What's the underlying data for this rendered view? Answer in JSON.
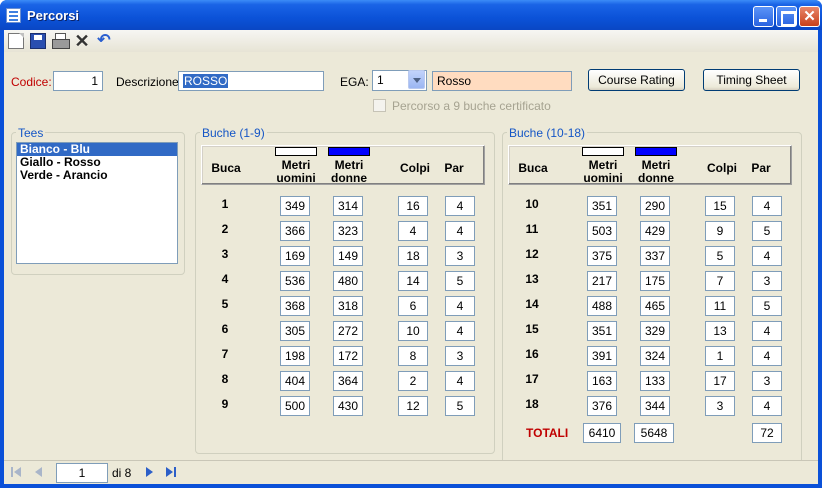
{
  "window": {
    "title": "Percorsi"
  },
  "toolbar": {
    "icons": [
      "new-icon",
      "save-icon",
      "print-icon",
      "delete-icon",
      "undo-icon"
    ]
  },
  "form": {
    "codice_label": "Codice:",
    "codice_value": "1",
    "descrizione_label": "Descrizione:",
    "descrizione_value": "ROSSO",
    "ega_label": "EGA:",
    "ega_value": "1",
    "ega_color_value": "Rosso",
    "course_rating_label": "Course Rating",
    "timing_sheet_label": "Timing Sheet",
    "certified_label": "Percorso a 9 buche certificato"
  },
  "tees": {
    "caption": "Tees",
    "items": [
      "Bianco - Blu",
      "Giallo - Rosso",
      "Verde - Arancio"
    ],
    "selected": 0
  },
  "headers": {
    "buca": "Buca",
    "metri": "Metri",
    "uomini": "uomini",
    "donne": "donne",
    "colpi": "Colpi",
    "par": "Par"
  },
  "colors": {
    "men_tee": "#ffffff",
    "women_tee": "#0000ff",
    "label_red": "#c00000",
    "ega_field_bg": "#ffdcc0"
  },
  "front9": {
    "caption": "Buche (1-9)",
    "rows": [
      {
        "buca": "1",
        "uomini": "349",
        "donne": "314",
        "colpi": "16",
        "par": "4"
      },
      {
        "buca": "2",
        "uomini": "366",
        "donne": "323",
        "colpi": "4",
        "par": "4"
      },
      {
        "buca": "3",
        "uomini": "169",
        "donne": "149",
        "colpi": "18",
        "par": "3"
      },
      {
        "buca": "4",
        "uomini": "536",
        "donne": "480",
        "colpi": "14",
        "par": "5"
      },
      {
        "buca": "5",
        "uomini": "368",
        "donne": "318",
        "colpi": "6",
        "par": "4"
      },
      {
        "buca": "6",
        "uomini": "305",
        "donne": "272",
        "colpi": "10",
        "par": "4"
      },
      {
        "buca": "7",
        "uomini": "198",
        "donne": "172",
        "colpi": "8",
        "par": "3"
      },
      {
        "buca": "8",
        "uomini": "404",
        "donne": "364",
        "colpi": "2",
        "par": "4"
      },
      {
        "buca": "9",
        "uomini": "500",
        "donne": "430",
        "colpi": "12",
        "par": "5"
      }
    ]
  },
  "back9": {
    "caption": "Buche (10-18)",
    "rows": [
      {
        "buca": "10",
        "uomini": "351",
        "donne": "290",
        "colpi": "15",
        "par": "4"
      },
      {
        "buca": "11",
        "uomini": "503",
        "donne": "429",
        "colpi": "9",
        "par": "5"
      },
      {
        "buca": "12",
        "uomini": "375",
        "donne": "337",
        "colpi": "5",
        "par": "4"
      },
      {
        "buca": "13",
        "uomini": "217",
        "donne": "175",
        "colpi": "7",
        "par": "3"
      },
      {
        "buca": "14",
        "uomini": "488",
        "donne": "465",
        "colpi": "11",
        "par": "5"
      },
      {
        "buca": "15",
        "uomini": "351",
        "donne": "329",
        "colpi": "13",
        "par": "4"
      },
      {
        "buca": "16",
        "uomini": "391",
        "donne": "324",
        "colpi": "1",
        "par": "4"
      },
      {
        "buca": "17",
        "uomini": "163",
        "donne": "133",
        "colpi": "17",
        "par": "3"
      },
      {
        "buca": "18",
        "uomini": "376",
        "donne": "344",
        "colpi": "3",
        "par": "4"
      }
    ],
    "totals": {
      "label": "TOTALI",
      "uomini": "6410",
      "donne": "5648",
      "par": "72"
    }
  },
  "navigator": {
    "position": "1",
    "of_label": "di 8"
  }
}
